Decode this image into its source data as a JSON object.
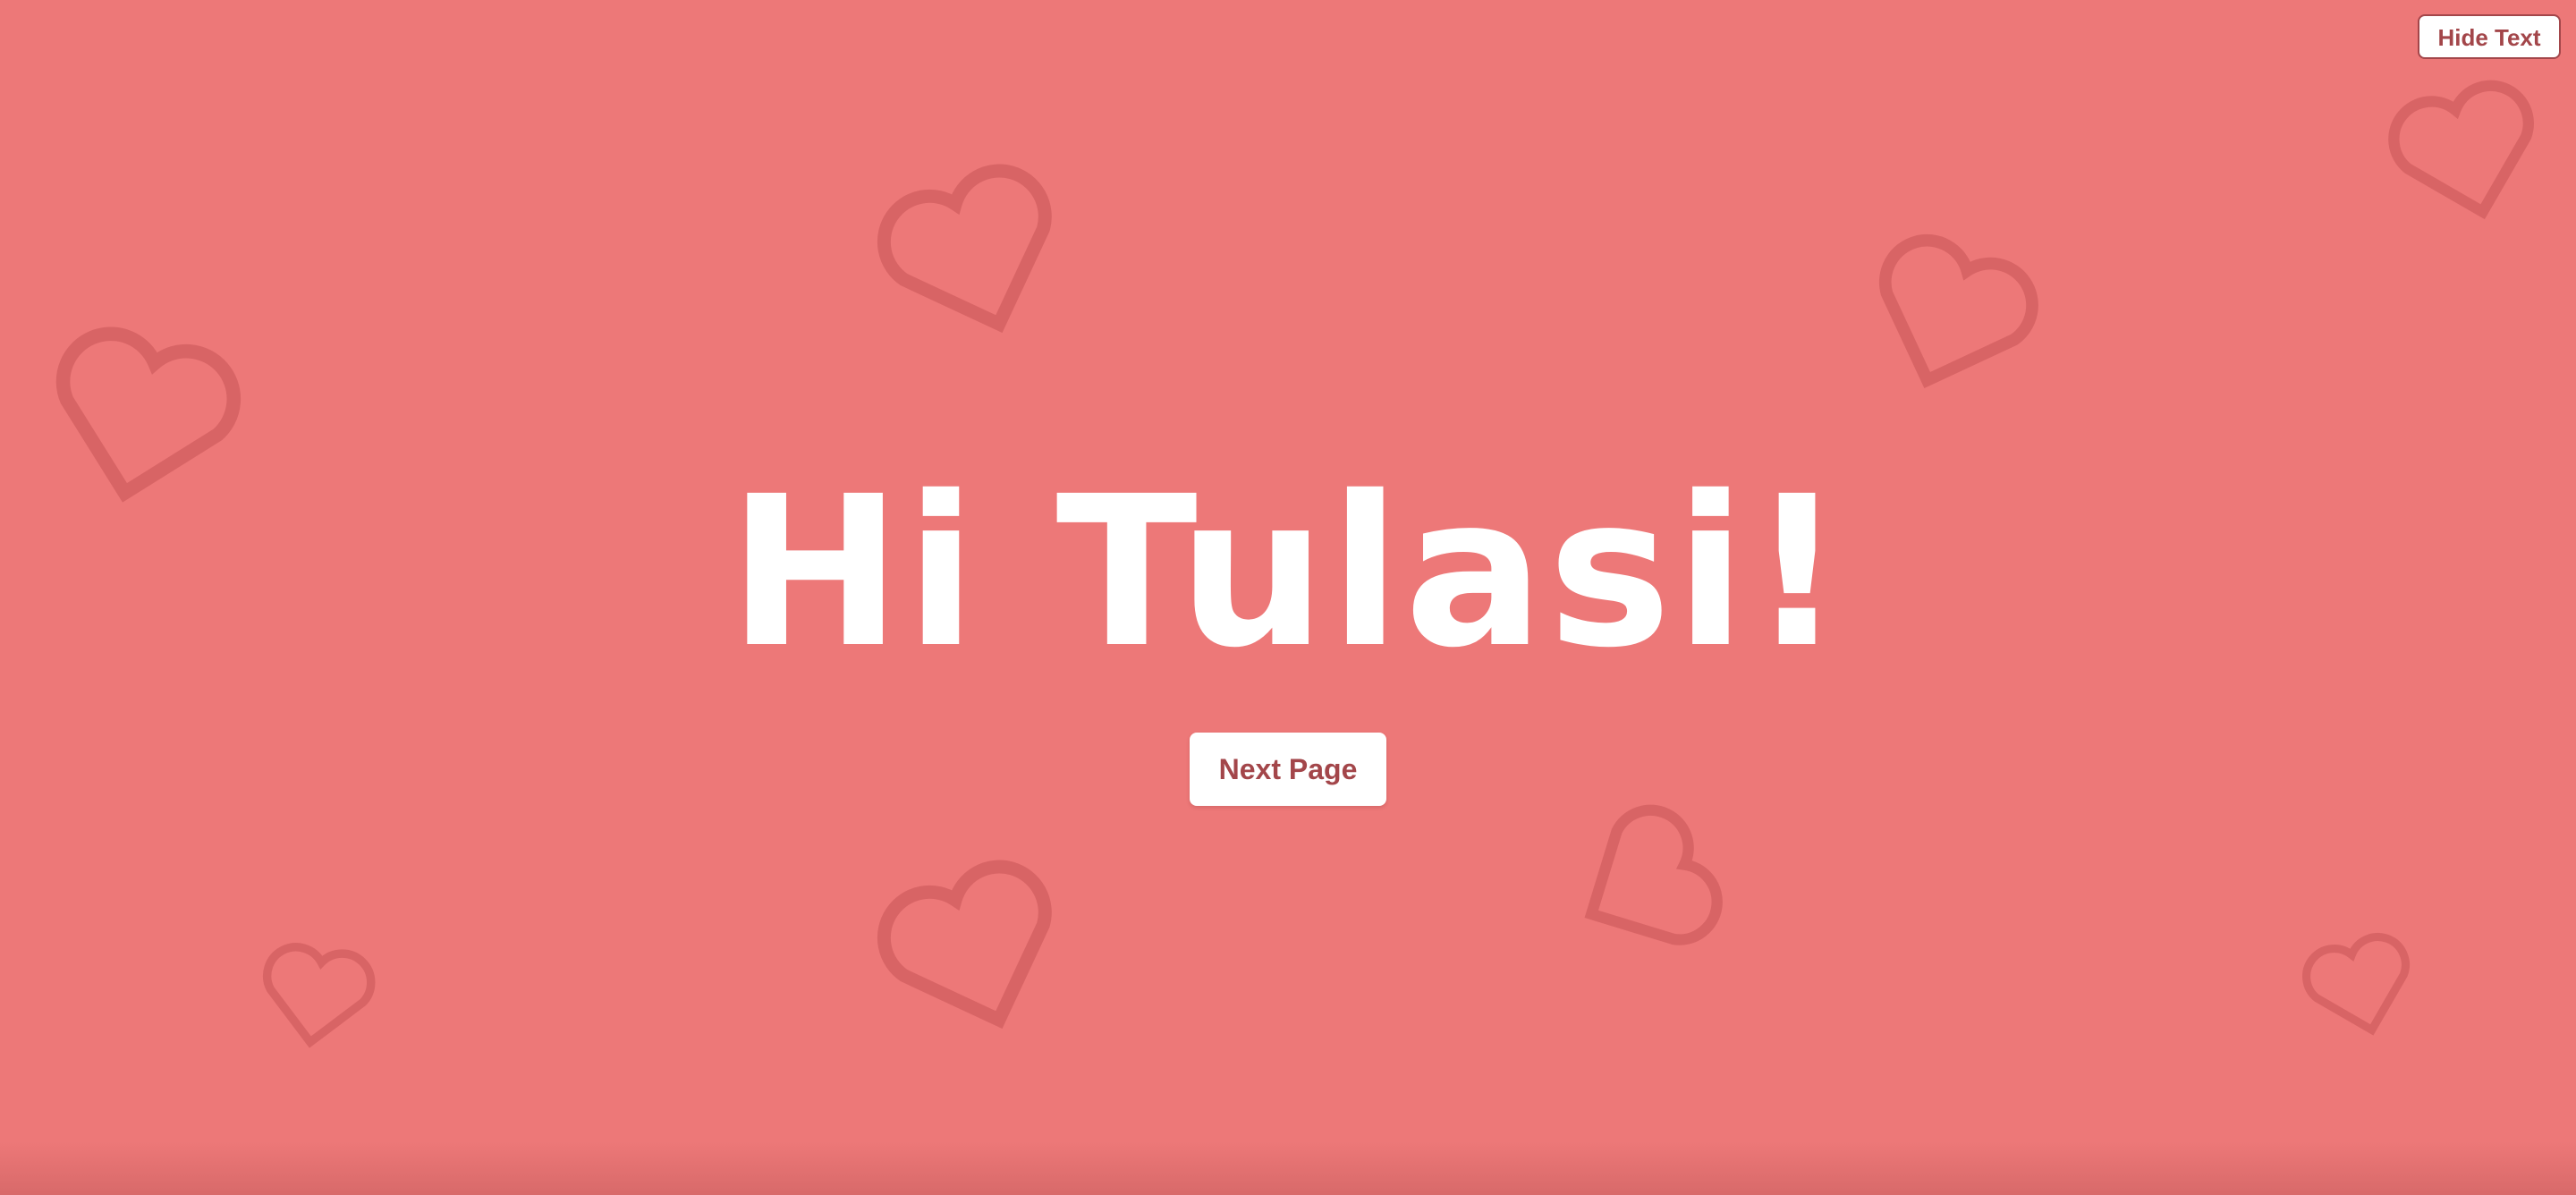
{
  "page": {
    "background_color": "#ed7878",
    "heart_outline_color": "#d86465"
  },
  "header": {
    "hide_text_label": "Hide Text"
  },
  "main": {
    "greeting": "Hi Tulasi!",
    "next_page_label": "Next Page"
  },
  "decorations": {
    "icon": "heart-outline-icon"
  }
}
